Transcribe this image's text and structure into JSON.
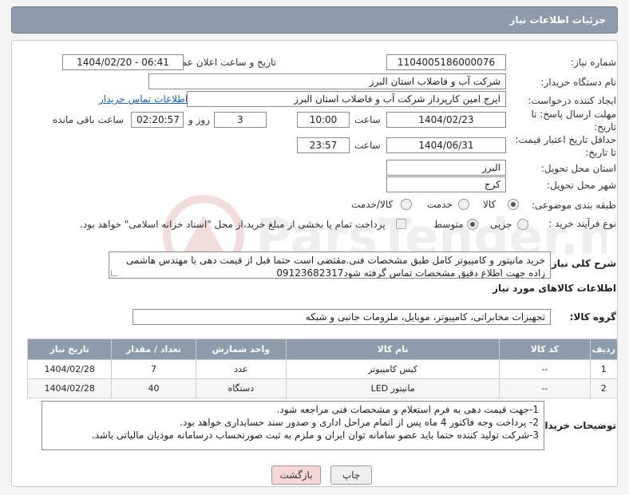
{
  "header": {
    "title": "جزئیات اطلاعات نیاز"
  },
  "form": {
    "need_number_label": "شماره نیاز:",
    "need_number": "1104005186000076",
    "announce_label": "تاریخ و ساعت اعلان عمومی:",
    "announce_value": "1404/02/20 - 06:41",
    "buyer_org_label": "نام دستگاه خریدار:",
    "buyer_org": "شرکت آب و فاضلاب استان البرز",
    "creator_label": "ایجاد کننده درخواست:",
    "creator": "ایرج امین کارپرداز شرکت آب و فاضلاب استان البرز",
    "contact_link": "اطلاعات تماس خریدار",
    "deadline_label_1": "مهلت ارسال پاسخ: تا",
    "deadline_label_2": "تاریخ:",
    "deadline_date": "1404/02/23",
    "time_label": "ساعت",
    "deadline_time": "10:00",
    "days_value": "3",
    "days_label": "روز و",
    "remaining_time": "02:20:57",
    "remaining_label": "ساعت باقی مانده",
    "validity_label_1": "حداقل تاریخ اعتبار قیمت:",
    "validity_label_2": "تا تاریخ:",
    "validity_date": "1404/06/31",
    "validity_time": "23:57",
    "province_label": "استان محل تحویل:",
    "province": "البرز",
    "city_label": "شهر محل تحویل:",
    "city": "کرج",
    "category_label": "طبقه بندی موضوعی:",
    "category_options": [
      "کالا",
      "خدمت",
      "کالا/خدمت"
    ],
    "category_selected": "کالا",
    "process_label": "نوع فرآیند خرید :",
    "process_options": [
      "جزیی",
      "متوسط"
    ],
    "process_selected": "متوسط",
    "payment_note": "پرداخت تمام یا بخشی از مبلغ خرید،از محل \"اسناد خزانه اسلامی\" خواهد بود.",
    "description_label": "شرح کلی نیاز:",
    "description": "خرید مانیتور و کامپیوتر کامل طبق مشخصات فنی.مقتضی است حتما قبل از قیمت دهی با مهندس هاشمی زاده جهت اطلاع دقیق مشخصات تماس گرفته شود09123682317"
  },
  "goods": {
    "section_title": "اطلاعات کالاهای مورد نیاز",
    "group_label": "گروه کالا:",
    "group_value": "تجهیزات مخابراتی، کامپیوتر، موبایل، ملزومات جانبی و شبکه",
    "columns": [
      "ردیف",
      "کد کالا",
      "نام کالا",
      "واحد شمارش",
      "تعداد / مقدار",
      "تاریخ نیاز"
    ],
    "rows": [
      {
        "row": "1",
        "code": "--",
        "name": "کیس کامپیوتر",
        "unit": "عدد",
        "qty": "7",
        "date": "1404/02/28"
      },
      {
        "row": "2",
        "code": "--",
        "name": "مانیتور LED",
        "unit": "دستگاه",
        "qty": "40",
        "date": "1404/02/28"
      }
    ]
  },
  "buyer_notes": {
    "label": "توضیحات خریدار:",
    "lines": [
      "1-جهت قیمت دهی به فرم استعلام و مشخصات فنی مراجعه شود.",
      "2- پرداخت وجه فاکتور 4 ماه پس از اتمام مراحل اداری و صدور سند حسابداری خواهد بود.",
      "3-شرکت تولید کننده حتما باید عضو سامانه توان ایران و ملزم به ثبت صورتحساب درسامانه مودیان مالیاتی باشد."
    ]
  },
  "buttons": {
    "print": "چاپ",
    "back": "بازگشت"
  },
  "watermark": {
    "text": "ParsTender.net"
  },
  "colors": {
    "header_bg": "#8e9bab",
    "link": "#1a5fb4",
    "back_button": "#f7d6d6"
  }
}
